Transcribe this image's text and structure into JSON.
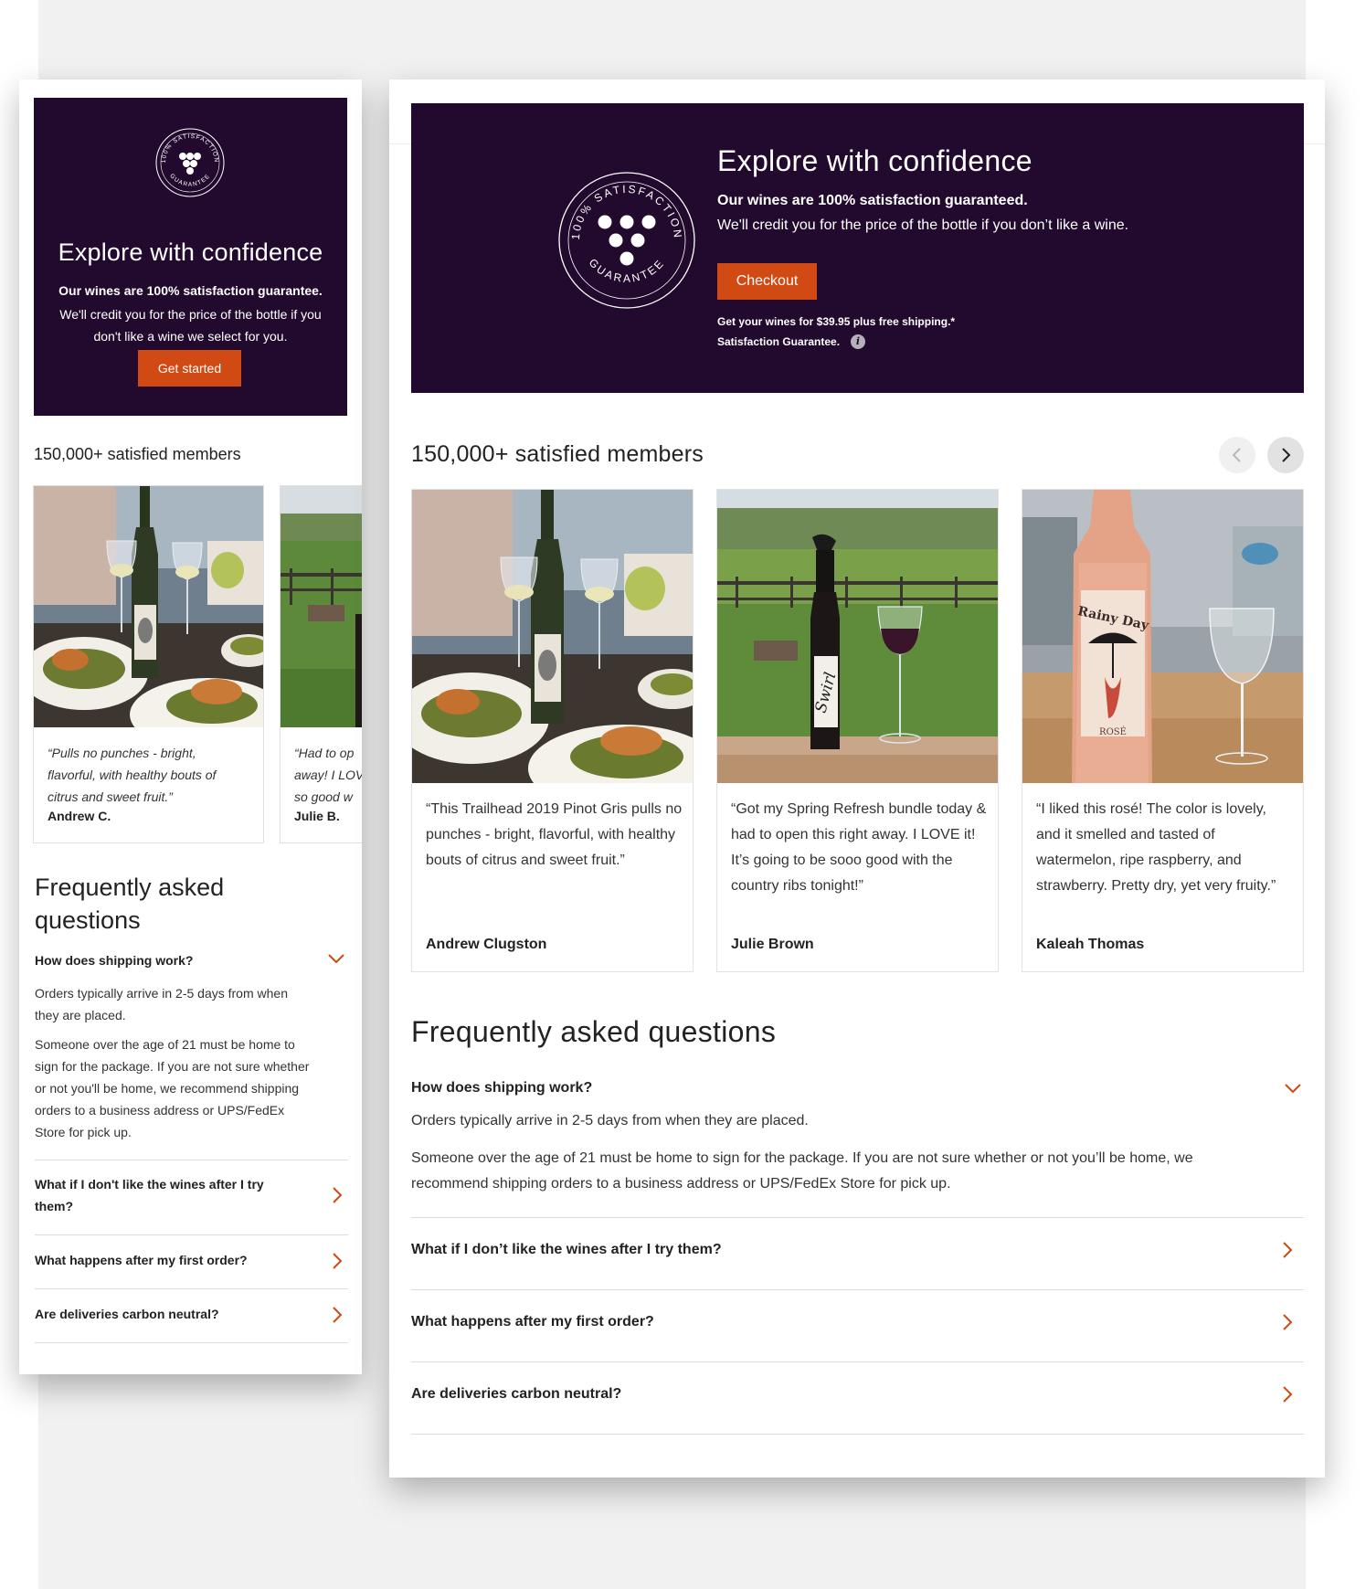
{
  "mobile": {
    "hero": {
      "seal_text_top": "100% SATISFACTION",
      "seal_text_bottom": "GUARANTEE",
      "title": "Explore with confidence",
      "bold": "Our wines are 100% satisfaction guarantee.",
      "body": "We'll credit you for the price of the bottle if you don't like a wine we select for you.",
      "button": "Get started"
    },
    "members_heading": "150,000+ satisfied members",
    "testimonials": [
      {
        "quote": "“Pulls no punches - bright,\nflavorful, with healthy bouts of\ncitrus and sweet fruit.”",
        "author": "Andrew C."
      },
      {
        "quote": "“Had to op\naway! I LOV\nso good w",
        "author": "Julie B."
      }
    ],
    "faq": {
      "title": "Frequently asked questions",
      "q1": "How does shipping work?",
      "a1": "Orders typically arrive in 2-5 days from when they are placed.",
      "a2": "Someone over the age of 21 must be home to sign for the package. If you are not sure whether or not you'll be home, we recommend shipping orders to a business address or UPS/FedEx Store for pick up.",
      "questions": [
        "What if I don't like the wines after I try them?",
        "What happens after my first order?",
        "Are deliveries carbon neutral?"
      ]
    }
  },
  "desktop": {
    "hero": {
      "seal_text_top": "100% SATISFACTION",
      "seal_text_bottom": "GUARANTEE",
      "title": "Explore with confidence",
      "bold": "Our wines are 100% satisfaction guaranteed.",
      "body": "We'll credit you for the price of the bottle if you don’t like a wine.",
      "button": "Checkout",
      "price_note": "Get your wines for $39.95 plus free shipping.*",
      "guarantee_note": "Satisfaction Guarantee.",
      "info_glyph": "i"
    },
    "members_heading": "150,000+ satisfied members",
    "testimonials": [
      {
        "quote": "“This Trailhead 2019 Pinot Gris pulls no punches - bright, flavorful, with healthy bouts of citrus and sweet fruit.”",
        "author": "Andrew Clugston"
      },
      {
        "quote": "“Got my Spring Refresh bundle today & had to open this right away. I LOVE it! It’s going to be sooo good with the country ribs tonight!”",
        "author": "Julie Brown"
      },
      {
        "quote": "“I liked this rosé! The color is lovely, and it smelled and tasted of watermelon, ripe raspberry, and strawberry. Pretty dry, yet very fruity.”",
        "author": "Kaleah Thomas"
      }
    ],
    "labels": {
      "swirl": "Swirl",
      "rainy_day": "Rainy Day",
      "rose": "ROSÉ"
    },
    "faq": {
      "title": "Frequently asked questions",
      "q1": "How does shipping work?",
      "a1": "Orders typically arrive in 2-5 days from when they are placed.",
      "a2": "Someone over the age of 21 must be home to sign for the package. If you are not sure whether or not you’ll be home, we recommend shipping orders to a business address or UPS/FedEx Store for pick up.",
      "questions": [
        "What if I don’t like the wines after I try them?",
        "What happens after my first order?",
        "Are deliveries carbon neutral?"
      ]
    }
  },
  "colors": {
    "hero_bg": "#220a2e",
    "accent": "#d24a13",
    "page_bg": "#f1f1f1"
  }
}
